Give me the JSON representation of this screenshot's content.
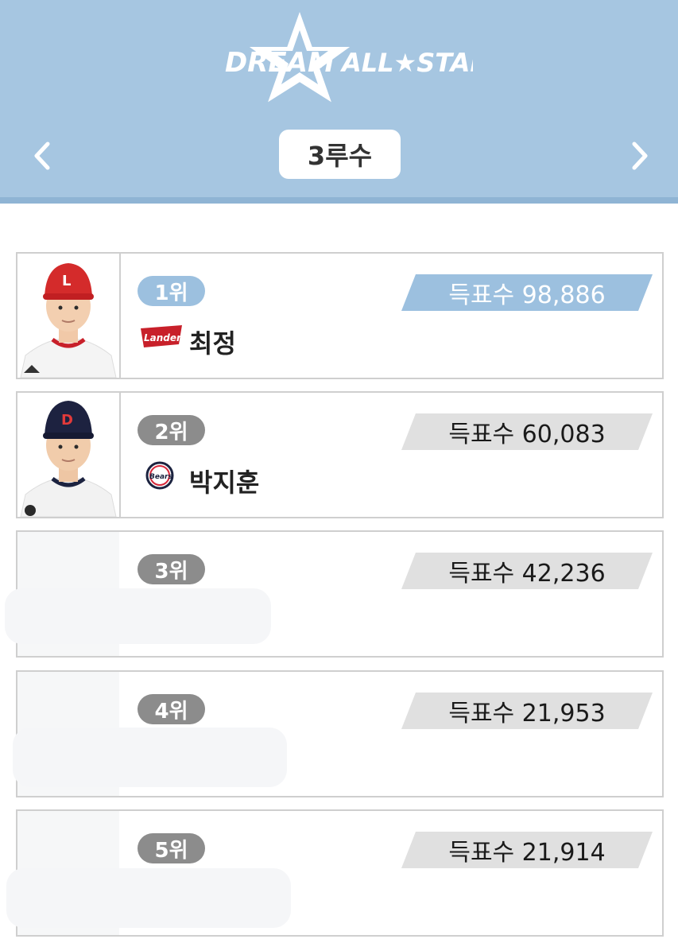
{
  "header": {
    "logo_text_left": "DREAM",
    "logo_text_right": "ALL★STAR",
    "position_label": "3루수",
    "prev_icon": "chevron-left-icon",
    "next_icon": "chevron-right-icon"
  },
  "ranking": [
    {
      "rank": "1위",
      "votes": "득표수 98,886",
      "name": "최정",
      "team": "SSG Landers",
      "team_logo_text": "Landers",
      "highlight": true
    },
    {
      "rank": "2위",
      "votes": "득표수 60,083",
      "name": "박지훈",
      "team": "Doosan Bears",
      "team_logo_text": "Bears",
      "highlight": false
    },
    {
      "rank": "3위",
      "votes": "득표수 42,236",
      "name": "",
      "highlight": false
    },
    {
      "rank": "4위",
      "votes": "득표수 21,953",
      "name": "",
      "highlight": false
    },
    {
      "rank": "5위",
      "votes": "득표수 21,914",
      "name": "",
      "highlight": false
    }
  ],
  "colors": {
    "header_bg": "#a6c6e1",
    "highlight": "#9cc0df",
    "rank_gray": "#8c8c8c",
    "votes_gray": "#e0e0e0"
  }
}
